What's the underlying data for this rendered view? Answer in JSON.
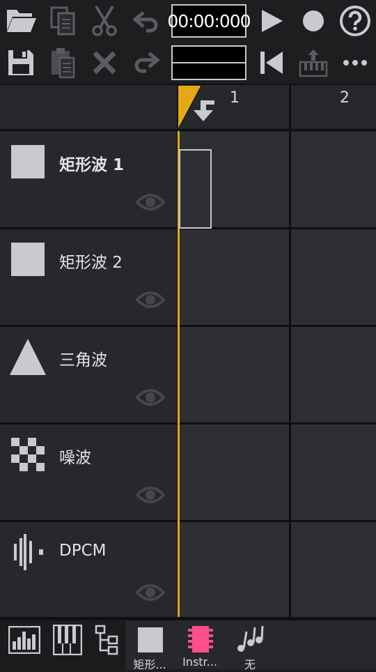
{
  "toolbar": {
    "time": "00:00:000",
    "icons_row1": [
      "folder-open-icon",
      "copy-icon",
      "cut-icon",
      "undo-icon",
      "play-icon",
      "record-icon",
      "help-icon"
    ],
    "icons_row2": [
      "save-icon",
      "paste-icon",
      "delete-icon",
      "redo-icon",
      "rewind-icon",
      "piano-export-icon",
      "more-icon"
    ]
  },
  "pattern_header": {
    "columns": [
      "1",
      "2"
    ]
  },
  "channels": [
    {
      "name": "矩形波 1",
      "icon": "square-wave-icon",
      "selected": true
    },
    {
      "name": "矩形波 2",
      "icon": "square-wave-icon",
      "selected": false
    },
    {
      "name": "三角波",
      "icon": "triangle-wave-icon",
      "selected": false
    },
    {
      "name": "噪波",
      "icon": "noise-icon",
      "selected": false
    },
    {
      "name": "DPCM",
      "icon": "dpcm-icon",
      "selected": false
    }
  ],
  "bottom_tabs": [
    {
      "label": "",
      "icon": "sequencer-icon"
    },
    {
      "label": "",
      "icon": "piano-roll-icon"
    },
    {
      "label": "",
      "icon": "project-tree-icon"
    },
    {
      "label": "矩形...",
      "icon": "square-wave-icon"
    },
    {
      "label": "Instr...",
      "icon": "instrument-chip-icon"
    },
    {
      "label": "无",
      "icon": "music-notes-icon"
    }
  ],
  "colors": {
    "accent": "#e6a814",
    "instrument": "#ff4f8b",
    "background": "#1d1e20",
    "panel": "#26282b"
  }
}
